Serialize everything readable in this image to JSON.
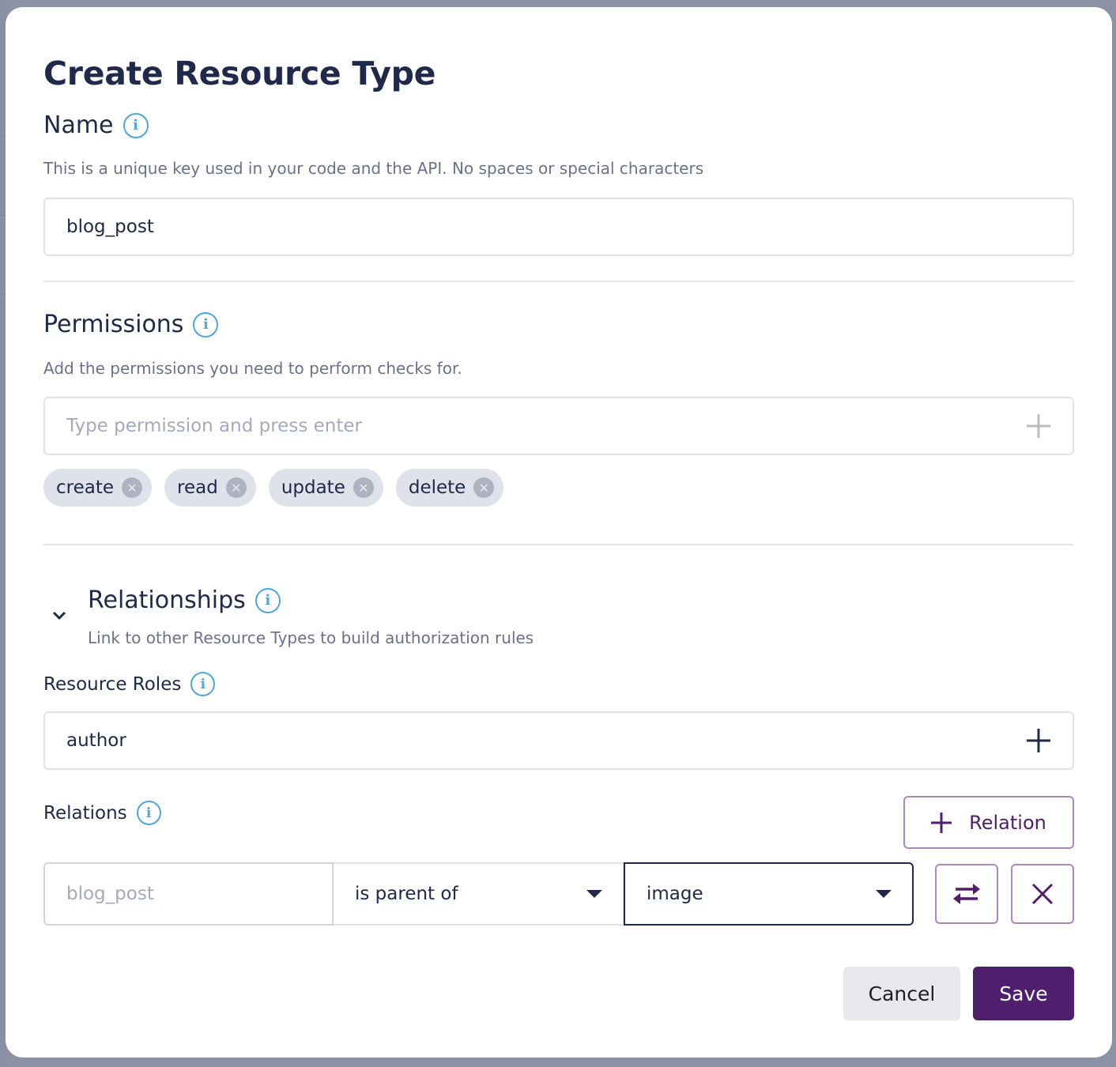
{
  "dialog": {
    "title": "Create Resource Type"
  },
  "name_section": {
    "label": "Name",
    "info_icon": "info-icon",
    "description": "This is a unique key used in your code and the API. No spaces or special characters",
    "value": "blog_post"
  },
  "permissions_section": {
    "label": "Permissions",
    "info_icon": "info-icon",
    "description": "Add the permissions you need to perform checks for.",
    "placeholder": "Type permission and press enter",
    "add_icon": "plus-icon",
    "chips": [
      {
        "label": "create",
        "remove_icon": "close-circle-icon"
      },
      {
        "label": "read",
        "remove_icon": "close-circle-icon"
      },
      {
        "label": "update",
        "remove_icon": "close-circle-icon"
      },
      {
        "label": "delete",
        "remove_icon": "close-circle-icon"
      }
    ]
  },
  "relationships_section": {
    "label": "Relationships",
    "expanded": true,
    "collapse_icon": "chevron-down-icon",
    "info_icon": "info-icon",
    "description": "Link to other Resource Types to build authorization rules",
    "resource_roles": {
      "label": "Resource Roles",
      "value": "author",
      "add_icon": "plus-icon"
    },
    "relations": {
      "label": "Relations",
      "add_button_label": "Relation",
      "rows": [
        {
          "subject": "blog_post",
          "relation": "is parent of",
          "object": "image",
          "swap_icon": "swap-arrows-icon",
          "remove_icon": "close-icon"
        }
      ]
    }
  },
  "footer": {
    "cancel_label": "Cancel",
    "save_label": "Save"
  },
  "colors": {
    "accent": "#4f1f6e",
    "info": "#4da6e0",
    "text": "#21294a",
    "muted": "#6c7189",
    "chip_bg": "#dfe2ea"
  }
}
